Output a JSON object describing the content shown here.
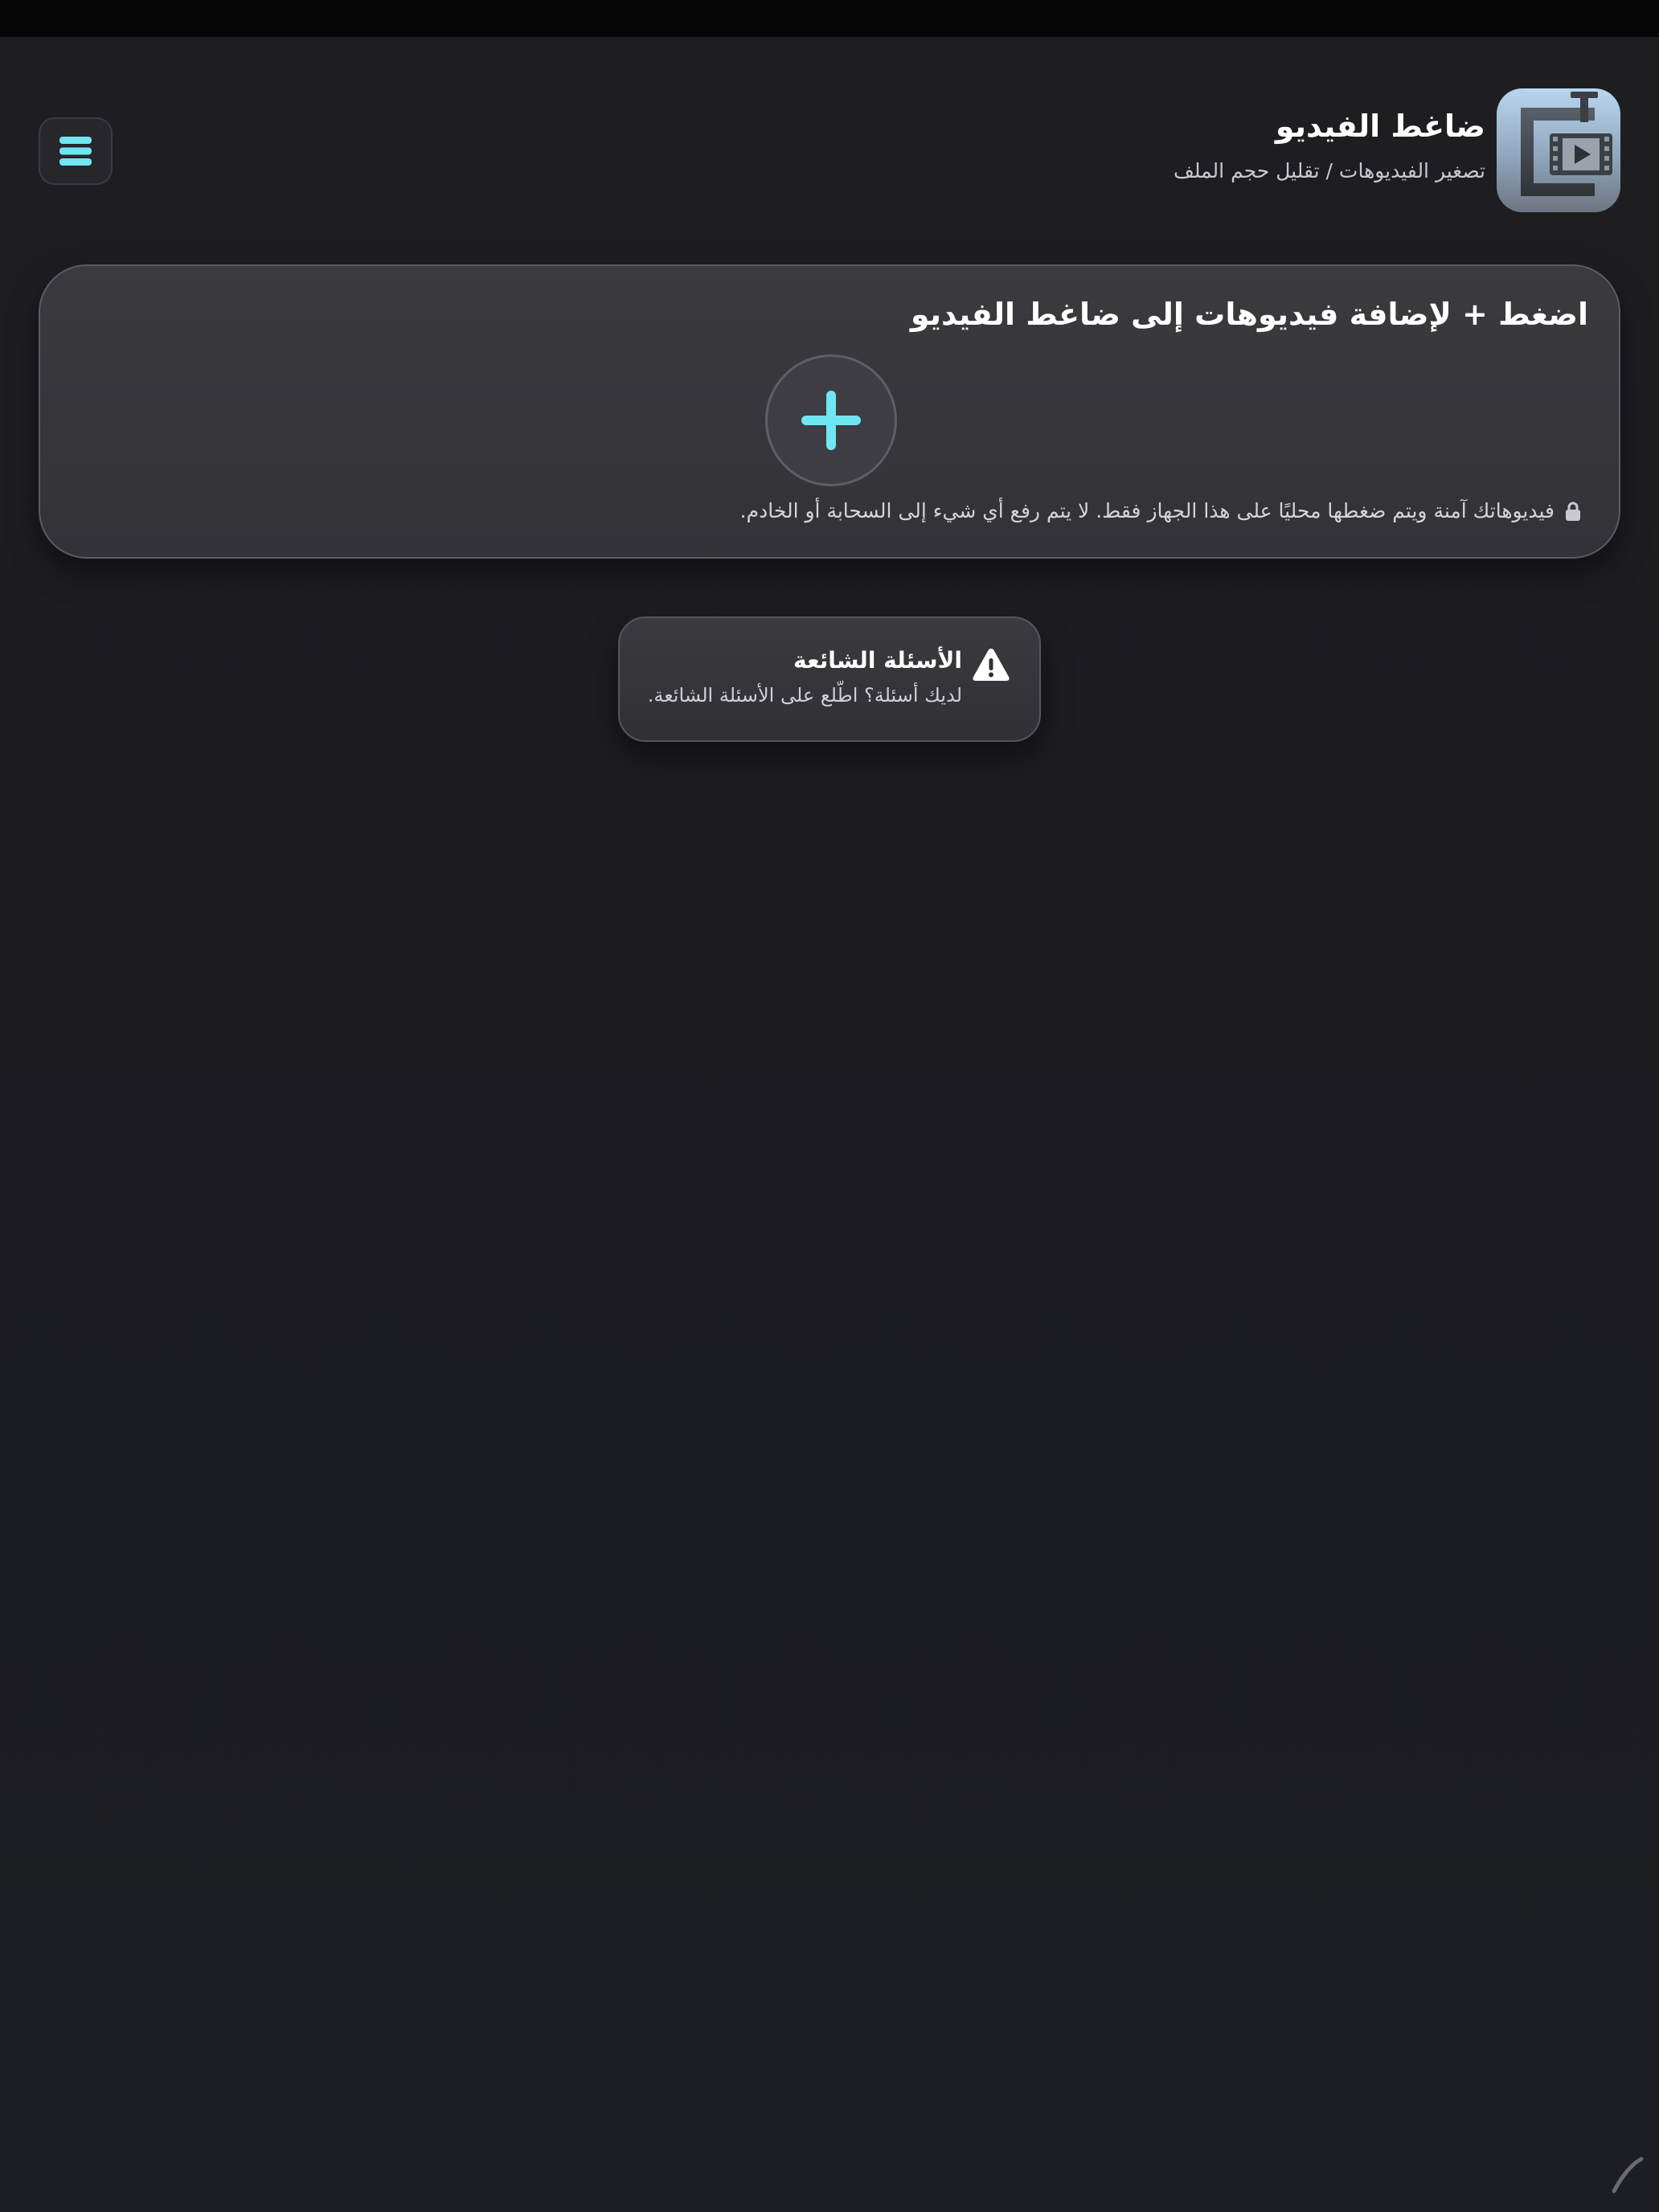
{
  "header": {
    "title": "ضاغط الفيديو",
    "subtitle": "تصغير الفيديوهات / تقليل حجم الملف",
    "app_icon": "video-compressor-clamp-icon",
    "menu_icon": "hamburger-menu-icon"
  },
  "add_card": {
    "title": "اضغط + لإضافة فيديوهات إلى ضاغط الفيديو",
    "add_icon": "plus-icon",
    "privacy_icon": "lock-icon",
    "privacy_text": "فيديوهاتك آمنة ويتم ضغطها محليًا على هذا الجهاز فقط. لا يتم رفع أي شيء إلى السحابة أو الخادم."
  },
  "faq": {
    "icon": "warning-icon",
    "title": "الأسئلة الشائعة",
    "text": "لديك أسئلة؟ اطّلع على الأسئلة الشائعة."
  },
  "colors": {
    "accent": "#6fe6f2",
    "background": "#1c1c21",
    "card": "#38383d"
  }
}
